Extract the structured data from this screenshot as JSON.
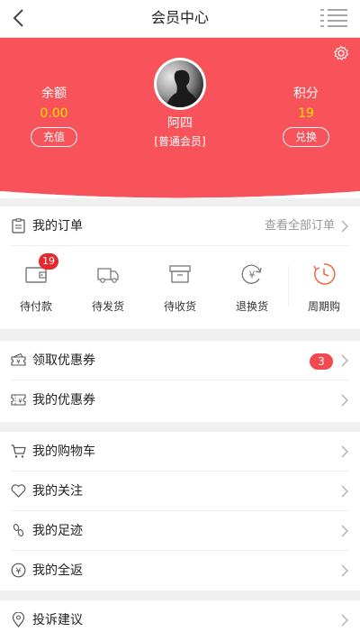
{
  "nav": {
    "title": "会员中心"
  },
  "profile": {
    "name": "阿四",
    "level": "[普通会员]",
    "balance_label": "余额",
    "balance_value": "0.00",
    "recharge_label": "充值",
    "points_label": "积分",
    "points_value": "19",
    "exchange_label": "兑换"
  },
  "orders": {
    "title": "我的订单",
    "view_all": "查看全部订单",
    "items": [
      {
        "label": "待付款",
        "icon": "wallet-icon",
        "badge": "19"
      },
      {
        "label": "待发货",
        "icon": "truck-icon"
      },
      {
        "label": "待收货",
        "icon": "box-icon"
      },
      {
        "label": "退换货",
        "icon": "yuan-refresh-icon"
      },
      {
        "label": "周期购",
        "icon": "clock-icon"
      }
    ]
  },
  "coupons": [
    {
      "label": "领取优惠券",
      "icon": "coupon-receive-icon",
      "count": "3"
    },
    {
      "label": "我的优惠券",
      "icon": "coupon-icon"
    }
  ],
  "menu": [
    {
      "label": "我的购物车",
      "icon": "cart-icon"
    },
    {
      "label": "我的关注",
      "icon": "heart-icon"
    },
    {
      "label": "我的足迹",
      "icon": "footprint-icon"
    },
    {
      "label": "我的全返",
      "icon": "yuan-circle-icon"
    }
  ],
  "feedback": {
    "label": "投诉建议",
    "icon": "location-pin-icon"
  },
  "colors": {
    "header": "#f8525a",
    "accent": "#f0673a",
    "badge": "#e8282a",
    "points": "#ffe000"
  }
}
